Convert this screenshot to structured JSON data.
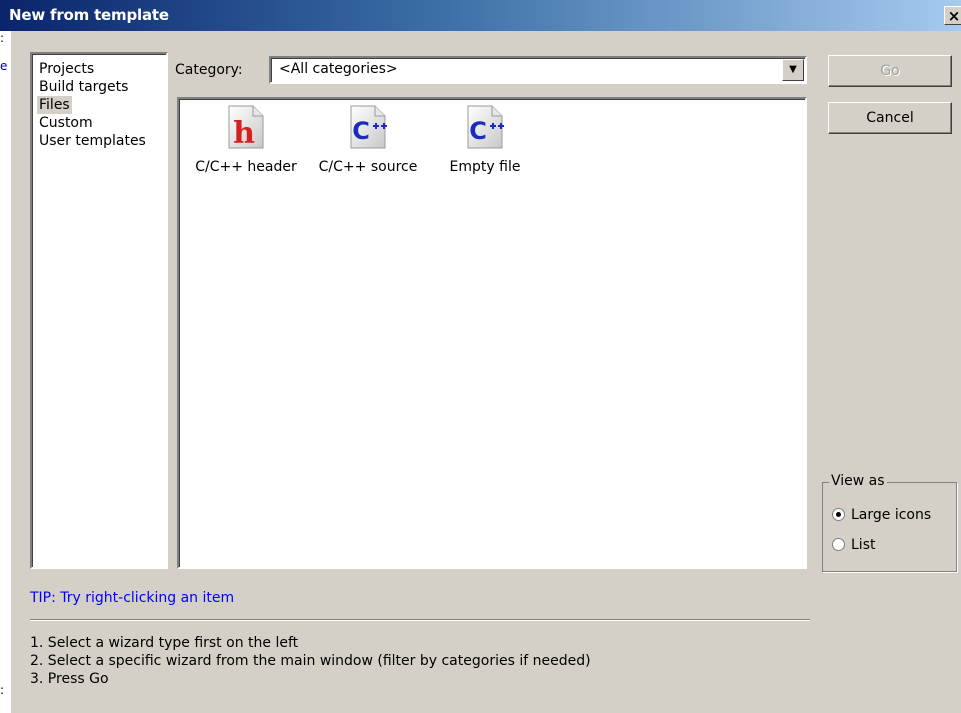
{
  "window": {
    "title": "New from template",
    "close_label": "×"
  },
  "left_strip": {
    "glyphs": [
      ":",
      "e",
      ":"
    ]
  },
  "wizard_types": {
    "items": [
      "Projects",
      "Build targets",
      "Files",
      "Custom",
      "User templates"
    ],
    "selected": "Files"
  },
  "category": {
    "label": "Category:",
    "value": "<All categories>",
    "dropdown_arrow": "▼"
  },
  "templates": [
    {
      "label": "C/C++ header",
      "icon": "c-header-file-icon",
      "glyph": "h",
      "glyph_color": "#d42020"
    },
    {
      "label": "C/C++ source",
      "icon": "cpp-source-file-icon",
      "glyph": "C",
      "glyph_color": "#1a2bbf"
    },
    {
      "label": "Empty file",
      "icon": "empty-file-icon",
      "glyph": "C",
      "glyph_color": "#1a2bbf"
    }
  ],
  "buttons": {
    "go": "Go",
    "cancel": "Cancel"
  },
  "view_as": {
    "legend": "View as",
    "options": [
      "Large icons",
      "List"
    ],
    "selected": "Large icons"
  },
  "tip": "TIP: Try right-clicking an item",
  "instructions": [
    "1. Select a wizard type first on the left",
    "2. Select a specific wizard from the main window (filter by categories if needed)",
    "3. Press Go"
  ],
  "colors": {
    "title_bar_start": "#0a246a",
    "title_bar_end": "#a6caf0",
    "tip_text": "#0000ff",
    "face": "#d4d0c8"
  }
}
